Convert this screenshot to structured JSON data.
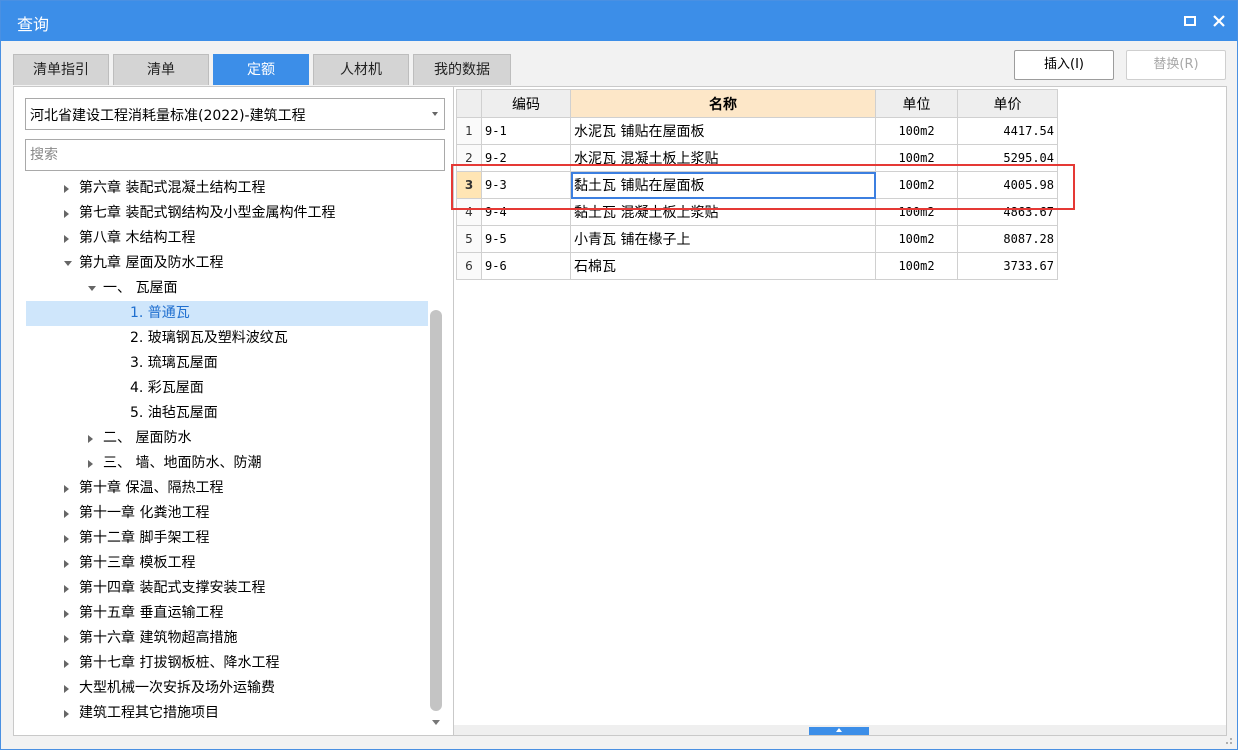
{
  "window": {
    "title": "查询",
    "restore_icon": "restore-icon",
    "close_icon": "close-icon"
  },
  "tabs": [
    {
      "label": "清单指引",
      "active": false
    },
    {
      "label": "清单",
      "active": false
    },
    {
      "label": "定额",
      "active": true
    },
    {
      "label": "人材机",
      "active": false
    },
    {
      "label": "我的数据",
      "active": false
    }
  ],
  "toolbar": {
    "insert_label": "插入(I)",
    "replace_label": "替换(R)"
  },
  "library": {
    "selected": "河北省建设工程消耗量标准(2022)-建筑工程"
  },
  "search": {
    "placeholder": "搜索"
  },
  "tree": [
    {
      "label": "第六章 装配式混凝土结构工程",
      "level": 0,
      "expander": "collapsed"
    },
    {
      "label": "第七章 装配式钢结构及小型金属构件工程",
      "level": 0,
      "expander": "collapsed"
    },
    {
      "label": "第八章 木结构工程",
      "level": 0,
      "expander": "collapsed"
    },
    {
      "label": "第九章 屋面及防水工程",
      "level": 0,
      "expander": "expanded"
    },
    {
      "label": "一、 瓦屋面",
      "level": 1,
      "expander": "expanded"
    },
    {
      "label": "1. 普通瓦",
      "level": 2,
      "expander": "none",
      "selected": true
    },
    {
      "label": "2. 玻璃钢瓦及塑料波纹瓦",
      "level": 2,
      "expander": "none"
    },
    {
      "label": "3. 琉璃瓦屋面",
      "level": 2,
      "expander": "none"
    },
    {
      "label": "4. 彩瓦屋面",
      "level": 2,
      "expander": "none"
    },
    {
      "label": "5. 油毡瓦屋面",
      "level": 2,
      "expander": "none"
    },
    {
      "label": "二、 屋面防水",
      "level": 1,
      "expander": "collapsed"
    },
    {
      "label": "三、 墙、地面防水、防潮",
      "level": 1,
      "expander": "collapsed"
    },
    {
      "label": "第十章 保温、隔热工程",
      "level": 0,
      "expander": "collapsed"
    },
    {
      "label": "第十一章 化粪池工程",
      "level": 0,
      "expander": "collapsed"
    },
    {
      "label": "第十二章 脚手架工程",
      "level": 0,
      "expander": "collapsed"
    },
    {
      "label": "第十三章 模板工程",
      "level": 0,
      "expander": "collapsed"
    },
    {
      "label": "第十四章 装配式支撑安装工程",
      "level": 0,
      "expander": "collapsed"
    },
    {
      "label": "第十五章 垂直运输工程",
      "level": 0,
      "expander": "collapsed"
    },
    {
      "label": "第十六章 建筑物超高措施",
      "level": 0,
      "expander": "collapsed"
    },
    {
      "label": "第十七章 打拔钢板桩、降水工程",
      "level": 0,
      "expander": "collapsed"
    },
    {
      "label": "大型机械一次安拆及场外运输费",
      "level": 0,
      "expander": "collapsed"
    },
    {
      "label": "建筑工程其它措施项目",
      "level": 0,
      "expander": "collapsed"
    }
  ],
  "grid": {
    "headers": {
      "code": "编码",
      "name": "名称",
      "unit": "单位",
      "price": "单价"
    },
    "rows": [
      {
        "num": "1",
        "code": "9-1",
        "name": "水泥瓦 铺贴在屋面板",
        "unit": "100m2",
        "price": "4417.54"
      },
      {
        "num": "2",
        "code": "9-2",
        "name": "水泥瓦 混凝土板上浆贴",
        "unit": "100m2",
        "price": "5295.04"
      },
      {
        "num": "3",
        "code": "9-3",
        "name": "黏土瓦 铺贴在屋面板",
        "unit": "100m2",
        "price": "4005.98",
        "current": true
      },
      {
        "num": "4",
        "code": "9-4",
        "name": "黏土瓦 混凝土板上浆贴",
        "unit": "100m2",
        "price": "4863.67"
      },
      {
        "num": "5",
        "code": "9-5",
        "name": "小青瓦 铺在椽子上",
        "unit": "100m2",
        "price": "8087.28"
      },
      {
        "num": "6",
        "code": "9-6",
        "name": "石棉瓦",
        "unit": "100m2",
        "price": "3733.67"
      }
    ]
  },
  "colors": {
    "accent": "#3c8ee8",
    "highlight": "#e53935",
    "header_sort": "#fde7c8"
  }
}
